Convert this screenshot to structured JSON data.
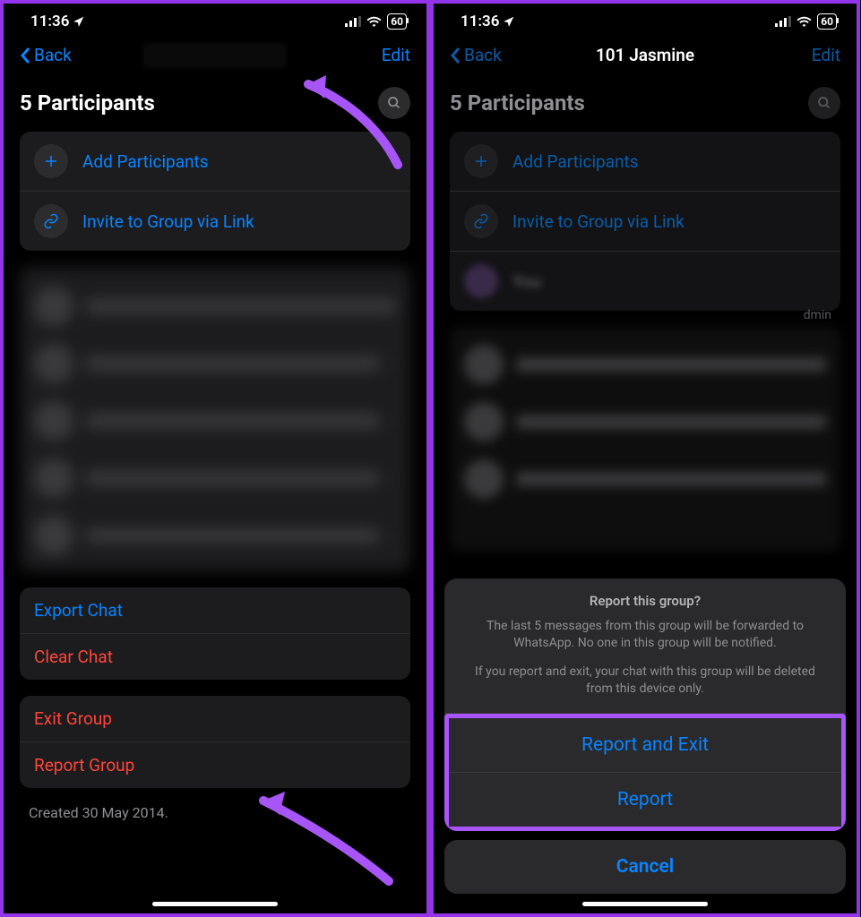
{
  "status": {
    "time": "11:36",
    "battery": "60"
  },
  "nav": {
    "back": "Back",
    "edit": "Edit",
    "title_right": "101 Jasmine"
  },
  "section": {
    "participants_title": "5 Participants"
  },
  "actions": {
    "add_participants": "Add Participants",
    "invite_link": "Invite to Group via Link",
    "export_chat": "Export Chat",
    "clear_chat": "Clear Chat",
    "exit_group": "Exit Group",
    "report_group": "Report Group"
  },
  "footer": {
    "created": "Created 30 May 2014."
  },
  "right_extras": {
    "you_label": "You",
    "admin": "dmin"
  },
  "sheet": {
    "title": "Report this group?",
    "desc1": "The last 5 messages from this group will be forwarded to WhatsApp. No one in this group will be notified.",
    "desc2": "If you report and exit, your chat with this group will be deleted from this device only.",
    "report_exit": "Report and Exit",
    "report": "Report",
    "cancel": "Cancel"
  }
}
